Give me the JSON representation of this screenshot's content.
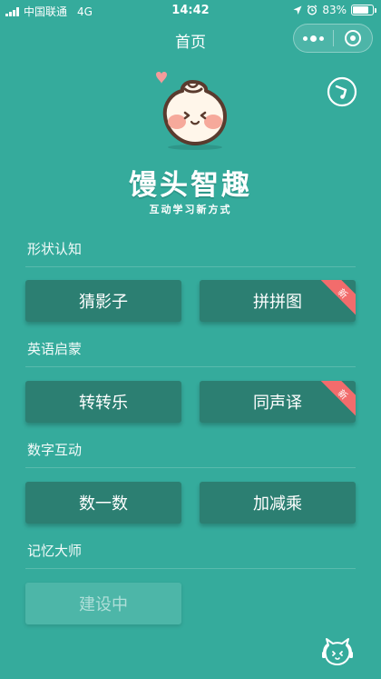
{
  "status_bar": {
    "carrier": "中国联通",
    "network": "4G",
    "time": "14:42",
    "battery_percent": "83%",
    "battery_level": 0.83
  },
  "nav": {
    "title": "首页"
  },
  "brand": {
    "title": "馒头智趣",
    "subtitle": "互动学习新方式"
  },
  "sections": [
    {
      "label": "形状认知",
      "buttons": [
        {
          "label": "猜影子"
        },
        {
          "label": "拼拼图",
          "badge": "新"
        }
      ]
    },
    {
      "label": "英语启蒙",
      "buttons": [
        {
          "label": "转转乐"
        },
        {
          "label": "同声译",
          "badge": "新"
        }
      ]
    },
    {
      "label": "数字互动",
      "buttons": [
        {
          "label": "数一数"
        },
        {
          "label": "加减乘"
        }
      ]
    },
    {
      "label": "记忆大师",
      "buttons": [
        {
          "label": "建设中"
        }
      ]
    }
  ],
  "icons": {
    "music": "music-note-icon",
    "support": "cat-support-icon",
    "more": "more-dots-icon",
    "close": "target-circle-icon"
  },
  "colors": {
    "background": "#35ab9c",
    "button": "#2c7f72",
    "disabled_button": "#4db6a8",
    "badge": "#f26c6c"
  }
}
